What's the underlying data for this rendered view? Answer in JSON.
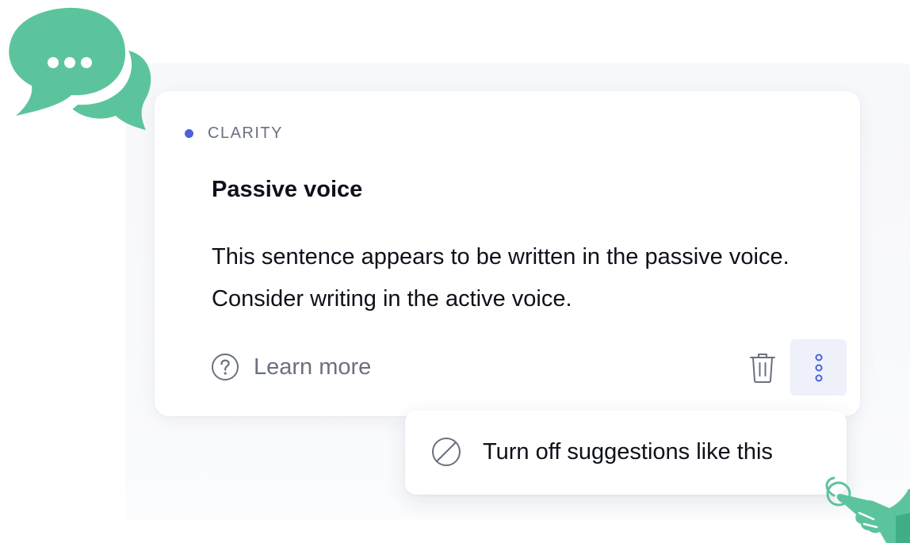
{
  "card": {
    "category": "CLARITY",
    "title": "Passive voice",
    "body": "This sentence appears to be written in the passive voice. Consider writing in the active voice.",
    "learn_more": "Learn more"
  },
  "menu": {
    "turn_off_label": "Turn off suggestions like this"
  },
  "icons": {
    "chat": "chat-bubbles-icon",
    "question": "question-circle-icon",
    "trash": "trash-icon",
    "more": "more-vertical-icon",
    "block": "block-icon",
    "hand": "pointing-hand-icon"
  },
  "colors": {
    "accent_dot": "#4a63d6",
    "illustration_green": "#5cc49d",
    "more_button_bg": "#eef0fa",
    "text_primary": "#0e101a",
    "text_secondary": "#6b7080"
  }
}
